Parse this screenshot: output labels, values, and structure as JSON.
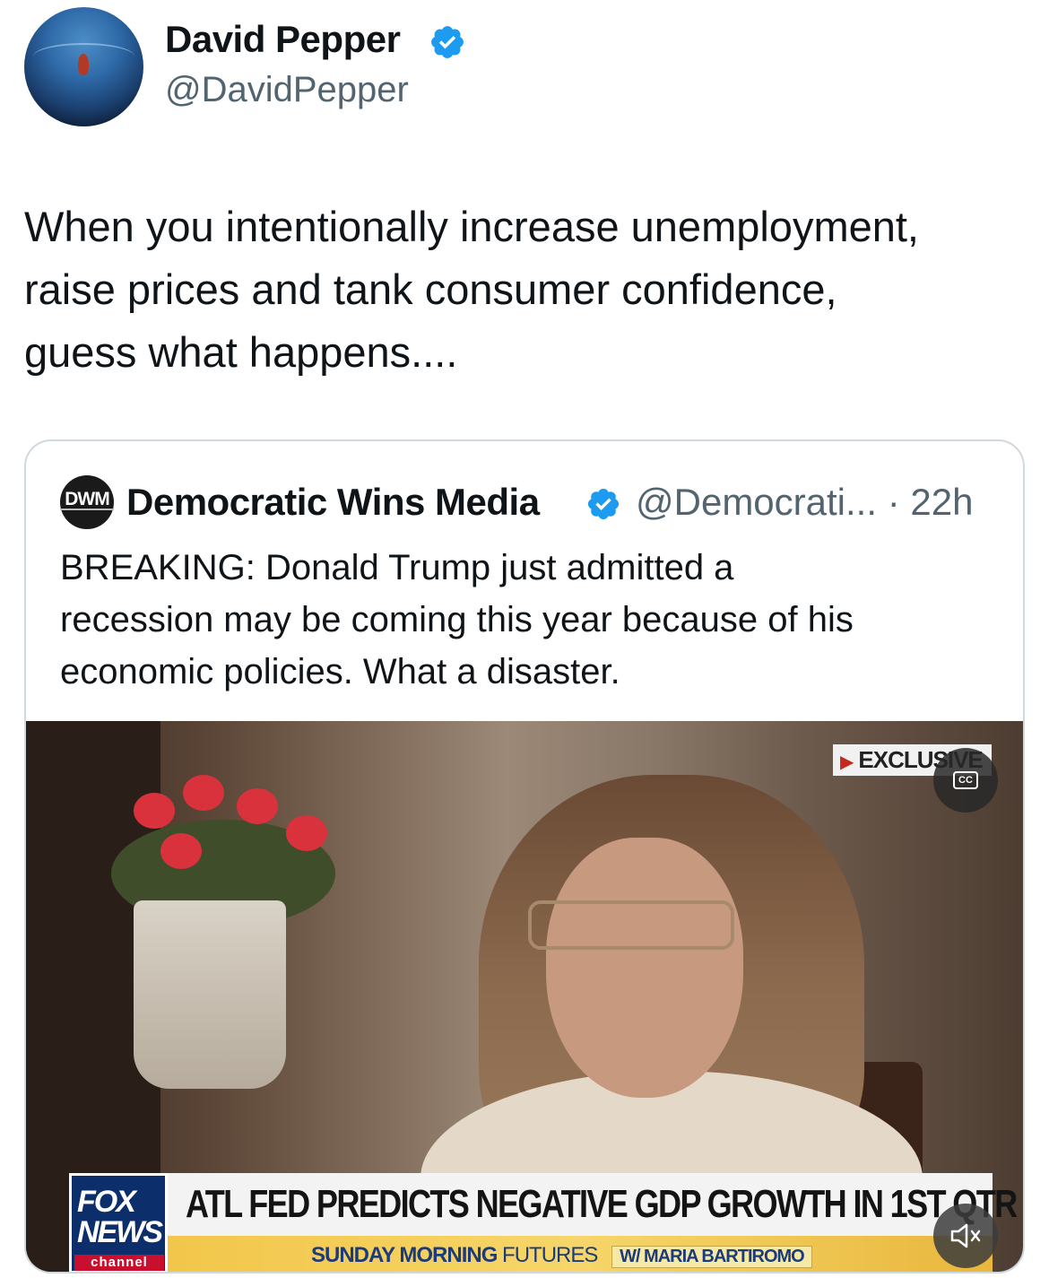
{
  "author": {
    "name": "David Pepper",
    "handle": "@DavidPepper",
    "verified_color": "#1d9bf0"
  },
  "tweet": {
    "text_lines": [
      "When you intentionally increase unemployment,",
      "raise prices and tank consumer confidence,",
      "guess what happens...."
    ]
  },
  "quote": {
    "avatar_text": "DWM",
    "name": "Democratic Wins Media",
    "handle_time": "@Democrati... · 22h",
    "text_lines": [
      "BREAKING: Donald Trump just admitted a",
      "recession may be coming this year because of his",
      "economic policies. What a disaster."
    ]
  },
  "video": {
    "badge": "EXCLUSIVE",
    "cc_label": "CC",
    "logo_line1": "FOX",
    "logo_line2": "NEWS",
    "logo_line3": "channel",
    "headline": "ATL FED PREDICTS NEGATIVE GDP GROWTH IN 1ST QTR",
    "show_title": "SUNDAY MORNING",
    "show_subtitle": "FUTURES",
    "host": "W/ MARIA BARTIROMO",
    "muted": true
  },
  "icons": {
    "verified": "verified-badge-icon",
    "play": "play-triangle-icon",
    "captions": "closed-captions-icon",
    "mute": "speaker-muted-icon"
  }
}
